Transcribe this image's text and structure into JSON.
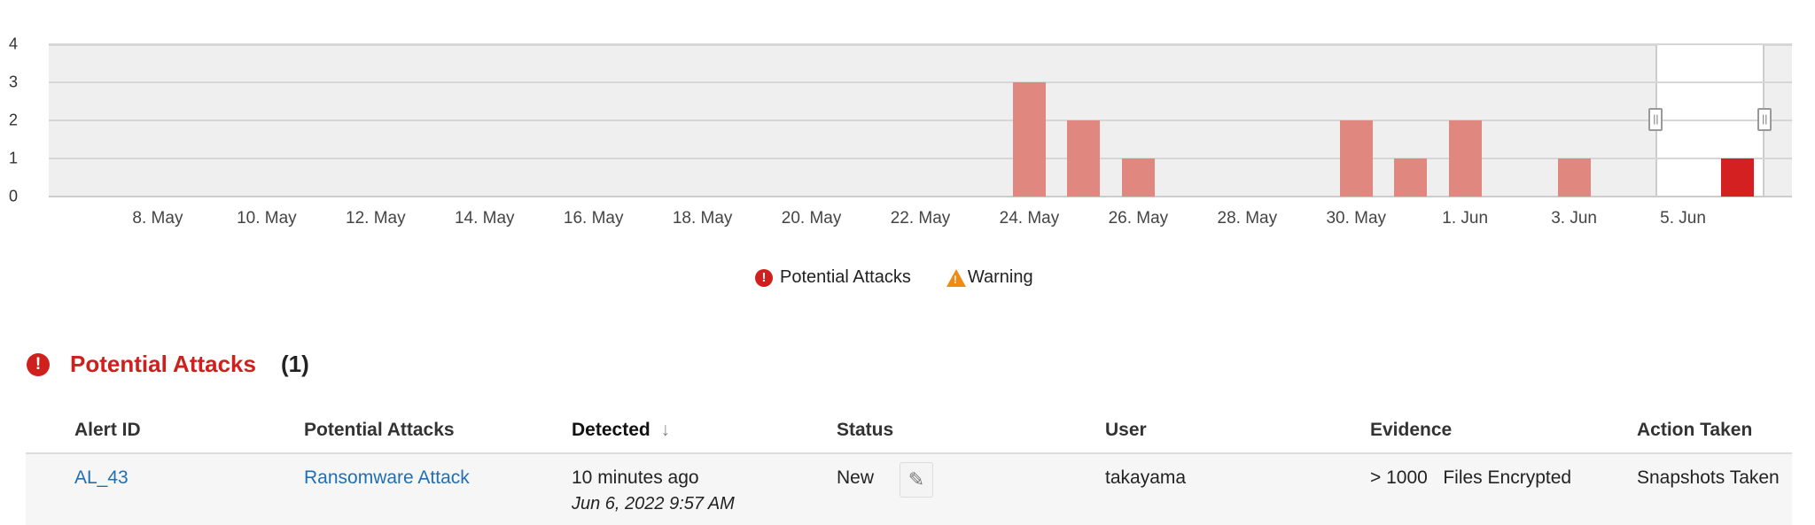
{
  "chart_data": {
    "type": "bar",
    "y_ticks": [
      "0",
      "1",
      "2",
      "3",
      "4"
    ],
    "ylim": [
      0,
      4
    ],
    "x_range": [
      "2022-05-06",
      "2022-06-07"
    ],
    "x_tick_labels": [
      {
        "date": "2022-05-08",
        "label": "8. May"
      },
      {
        "date": "2022-05-10",
        "label": "10. May"
      },
      {
        "date": "2022-05-12",
        "label": "12. May"
      },
      {
        "date": "2022-05-14",
        "label": "14. May"
      },
      {
        "date": "2022-05-16",
        "label": "16. May"
      },
      {
        "date": "2022-05-18",
        "label": "18. May"
      },
      {
        "date": "2022-05-20",
        "label": "20. May"
      },
      {
        "date": "2022-05-22",
        "label": "22. May"
      },
      {
        "date": "2022-05-24",
        "label": "24. May"
      },
      {
        "date": "2022-05-26",
        "label": "26. May"
      },
      {
        "date": "2022-05-28",
        "label": "28. May"
      },
      {
        "date": "2022-05-30",
        "label": "30. May"
      },
      {
        "date": "2022-06-01",
        "label": "1. Jun"
      },
      {
        "date": "2022-06-03",
        "label": "3. Jun"
      },
      {
        "date": "2022-06-05",
        "label": "5. Jun"
      }
    ],
    "series": [
      {
        "name": "Potential Attacks",
        "points": [
          {
            "date": "2022-05-24",
            "value": 3
          },
          {
            "date": "2022-05-25",
            "value": 2
          },
          {
            "date": "2022-05-26",
            "value": 1
          },
          {
            "date": "2022-05-30",
            "value": 2
          },
          {
            "date": "2022-05-31",
            "value": 1
          },
          {
            "date": "2022-06-01",
            "value": 2
          },
          {
            "date": "2022-06-03",
            "value": 1
          },
          {
            "date": "2022-06-06",
            "value": 1,
            "selected": true
          }
        ]
      }
    ],
    "navigator_range": [
      "2022-06-04T12:00",
      "2022-06-06T12:00"
    ],
    "colors": {
      "bar": "#e0877f",
      "bar_selected": "#d42020"
    },
    "legend": [
      "Potential Attacks",
      "Warning"
    ],
    "legend_position": "bottom-center"
  },
  "legend": {
    "attacks": "Potential Attacks",
    "warning": "Warning",
    "attacks_icon": "!",
    "warning_icon": "!"
  },
  "section": {
    "title": "Potential Attacks",
    "count": "(1)",
    "icon": "!"
  },
  "table": {
    "headers": [
      "Alert ID",
      "Potential Attacks",
      "Detected",
      "Status",
      "User",
      "Evidence",
      "Action Taken"
    ],
    "sort_icon": "↓",
    "rows": [
      {
        "alert_id": "AL_43",
        "attack": "Ransomware Attack",
        "detected": "10 minutes ago",
        "detected_time": "Jun 6, 2022 9:57 AM",
        "status": "New",
        "edit_icon": "✎",
        "user": "takayama",
        "evidence_count": "> 1000",
        "evidence": "Files Encrypted",
        "action": "Snapshots Taken"
      }
    ]
  }
}
